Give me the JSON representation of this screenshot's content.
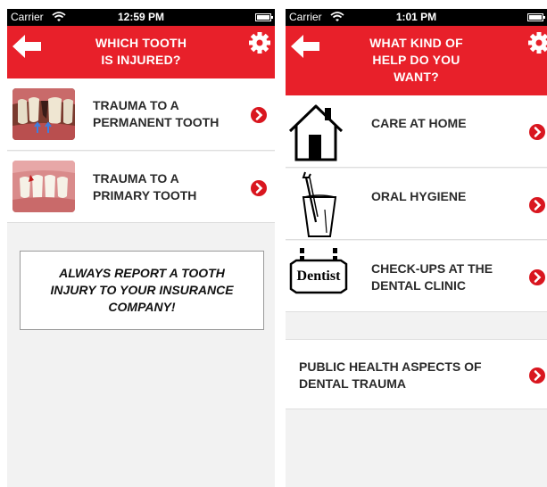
{
  "left_screen": {
    "status": {
      "carrier": "Carrier",
      "time": "12:59 PM"
    },
    "header": {
      "title_line1": "WHICH TOOTH",
      "title_line2": "IS INJURED?"
    },
    "rows": [
      {
        "label_line1": "TRAUMA TO A",
        "label_line2": "PERMANENT TOOTH"
      },
      {
        "label_line1": "TRAUMA TO A",
        "label_line2": "PRIMARY TOOTH"
      }
    ],
    "notice": {
      "line1": "ALWAYS REPORT A TOOTH",
      "line2": "INJURY TO YOUR INSURANCE",
      "line3": "COMPANY!"
    }
  },
  "right_screen": {
    "status": {
      "carrier": "Carrier",
      "time": "1:01 PM"
    },
    "header": {
      "title_line1": "WHAT KIND OF",
      "title_line2": "HELP DO YOU",
      "title_line3": "WANT?"
    },
    "rows": [
      {
        "label_line1": "CARE AT HOME",
        "icon": "house-icon"
      },
      {
        "label_line1": "ORAL HYGIENE",
        "icon": "toothbrush-glass-icon"
      },
      {
        "label_line1": "CHECK-UPS AT THE",
        "label_line2": "DENTAL CLINIC",
        "icon": "dentist-sign-icon",
        "sign_text": "Dentist"
      },
      {
        "label_line1": "PUBLIC HEALTH ASPECTS OF",
        "label_line2": "DENTAL TRAUMA"
      }
    ]
  },
  "colors": {
    "header_red": "#e8202a",
    "chevron_red": "#d9161f",
    "background": "#f2f2f2"
  }
}
